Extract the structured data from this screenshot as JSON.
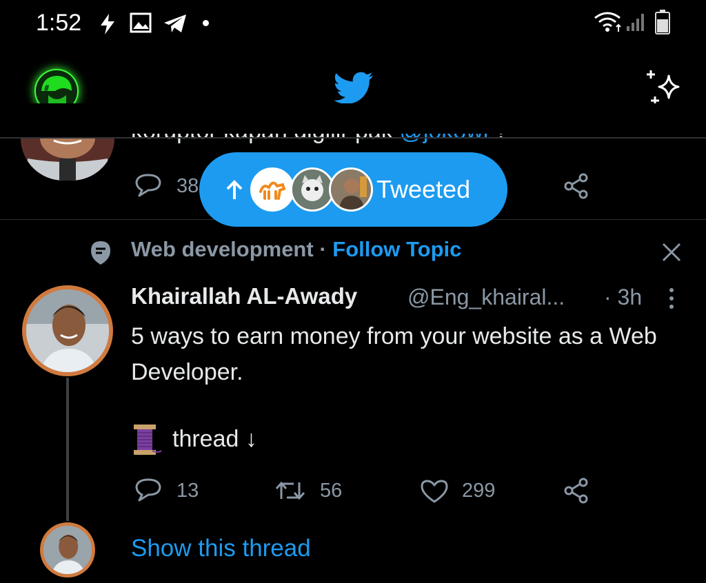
{
  "status_bar": {
    "time": "1:52"
  },
  "previous_tweet": {
    "text": "koruptor kapan digilir pak ",
    "mention": "@jokowi",
    "suffix": " ?",
    "reply_count": "38"
  },
  "new_tweets_pill": {
    "label": "Tweeted"
  },
  "topic": {
    "name": "Web development",
    "separator": " · ",
    "follow_label": "Follow Topic"
  },
  "tweet": {
    "display_name": "Khairallah AL-Awady",
    "handle": "@Eng_khairal...",
    "time": "· 3h",
    "text": "5 ways to earn money from your website as a Web Developer.",
    "thread_label": "thread ↓",
    "replies": "13",
    "retweets": "56",
    "likes": "299",
    "show_thread": "Show this thread"
  },
  "colors": {
    "background": "#000000",
    "accent": "#1d9bf0",
    "muted": "#8b98a5",
    "avatar_ring": "#d07a3f"
  }
}
